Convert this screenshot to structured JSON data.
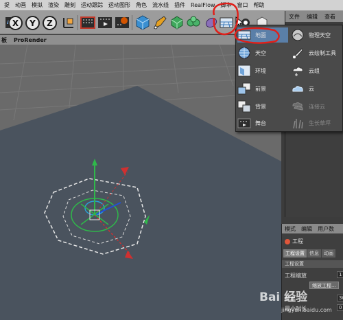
{
  "menubar": {
    "items": [
      "捉",
      "动画",
      "模拟",
      "渲染",
      "雕刻",
      "运动跟踪",
      "运动图形",
      "角色",
      "流水线",
      "插件",
      "RealFlow",
      "脚本",
      "窗口",
      "帮助"
    ]
  },
  "toolbar": {
    "axis_x": "X",
    "axis_y": "Y",
    "axis_z": "Z",
    "icons": [
      "undo-icon",
      "x-axis-icon",
      "y-axis-icon",
      "z-axis-icon",
      "coordinate-system-icon",
      "render-region-icon",
      "render-view-icon",
      "render-settings-icon",
      "cube-icon",
      "pen-icon",
      "subdivision-icon",
      "array-icon",
      "deformer-icon",
      "floor-environment-icon",
      "camera-icon",
      "light-icon"
    ]
  },
  "right_panel": {
    "tabs": [
      "文件",
      "编辑",
      "查看"
    ]
  },
  "viewport_bar": {
    "items": [
      "板",
      "ProRender"
    ]
  },
  "dropdown": {
    "left": [
      "地面",
      "天空",
      "环境",
      "前景",
      "背景",
      "舞台"
    ],
    "right": [
      "物理天空",
      "云绘制工具",
      "云组",
      "云",
      "连接云",
      "生长草坪"
    ]
  },
  "attributes": {
    "tabs_head": [
      "模式",
      "编辑",
      "用户数"
    ],
    "title": "工程",
    "tabs": [
      "工程设置",
      "信息",
      "动画"
    ],
    "section": "工程设置",
    "scale_label": "工程缩放",
    "scale_value": "1",
    "scale_button": "缩放工程...",
    "fps_label": "帧率",
    "fps_value": "30",
    "min_label": "最小时长",
    "min_value": "0"
  },
  "watermark": {
    "brand": "Bai 经验",
    "url": "jingyan.baidu.com"
  },
  "colors": {
    "annotation": "#e0201a",
    "floor": "#4a535e",
    "grid": "#6f6f6f",
    "highlight": "#5a7fa8"
  }
}
